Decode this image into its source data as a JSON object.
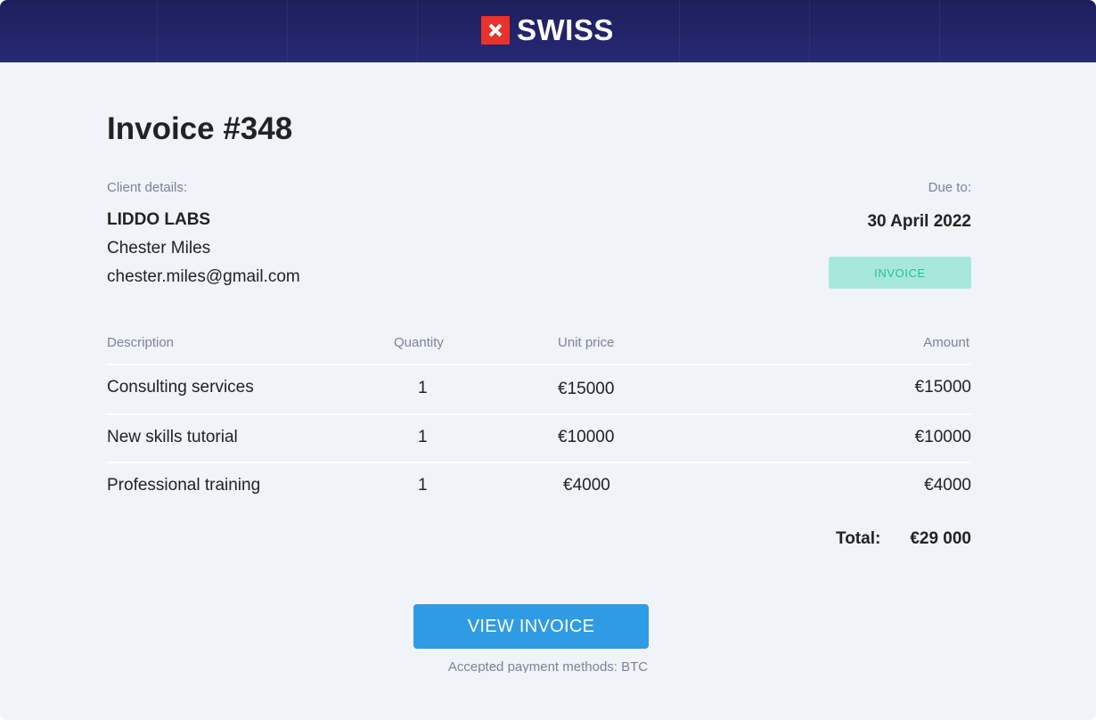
{
  "header": {
    "brand_name": "SWISS",
    "brand_icon": "swiss-flag-icon",
    "background_color": "#1d1e5c",
    "flag_color": "#e8322b"
  },
  "invoice": {
    "title": "Invoice #348",
    "client_label": "Client details:",
    "client_company": "LIDDO LABS",
    "client_name": "Chester Miles",
    "client_email": "chester.miles@gmail.com",
    "due_label": "Due to:",
    "due_date": "30 April 2022",
    "badge": "INVOICE"
  },
  "table": {
    "columns": [
      "Description",
      "Quantity",
      "Unit price",
      "Amount"
    ],
    "rows": [
      [
        "Consulting services",
        "1",
        "€15000",
        "€15000"
      ],
      [
        "New skills tutorial",
        "1",
        "€10000",
        "€10000"
      ],
      [
        "Professional training",
        "1",
        "€4000",
        "€4000"
      ]
    ],
    "total_label": "Total:",
    "total_value": "€29 000"
  },
  "actions": {
    "view_invoice": "VIEW INVOICE",
    "button_color": "#2f9be4"
  },
  "footer": {
    "payment_note": "Accepted payment methods: BTC"
  }
}
